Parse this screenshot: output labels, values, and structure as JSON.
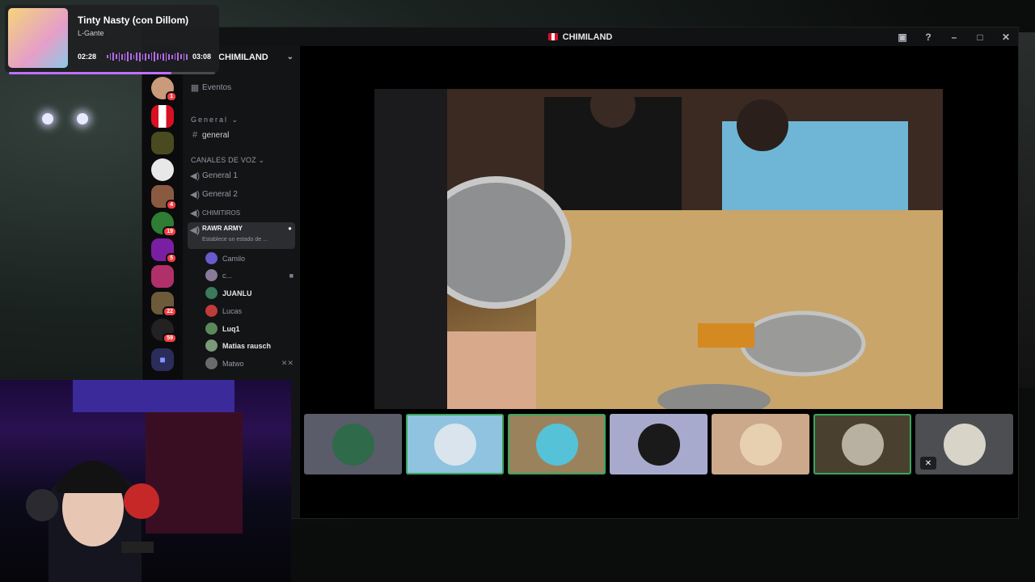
{
  "now_playing": {
    "title": "Tinty Nasty (con Dillom)",
    "artist": "L-Gante",
    "elapsed": "02:28",
    "duration": "03:08",
    "progress": 0.788
  },
  "window": {
    "title": "CHIMILAND"
  },
  "server": {
    "name": "CHIMILAND"
  },
  "guild_badges": [
    "1",
    "4",
    "19",
    "5",
    "22",
    "59"
  ],
  "channels": {
    "events": "Eventos",
    "category_general": "General",
    "text_channel": "general",
    "category_voice": "CANALES DE VOZ",
    "voice": [
      {
        "name": "General 1"
      },
      {
        "name": "General 2"
      },
      {
        "name": "CHIMITIROS"
      },
      {
        "name": "RAWR ARMY",
        "status": "Establece un estado de ..."
      }
    ]
  },
  "members": [
    "Camilo",
    "c...",
    "JUANLU",
    "Lucas",
    "Luq1",
    "Matias rausch",
    "Matwo"
  ],
  "colors": {
    "accent": "#5865f2",
    "speaking": "#3ba55d",
    "badge": "#f23f43",
    "progress": "#c070ff"
  }
}
